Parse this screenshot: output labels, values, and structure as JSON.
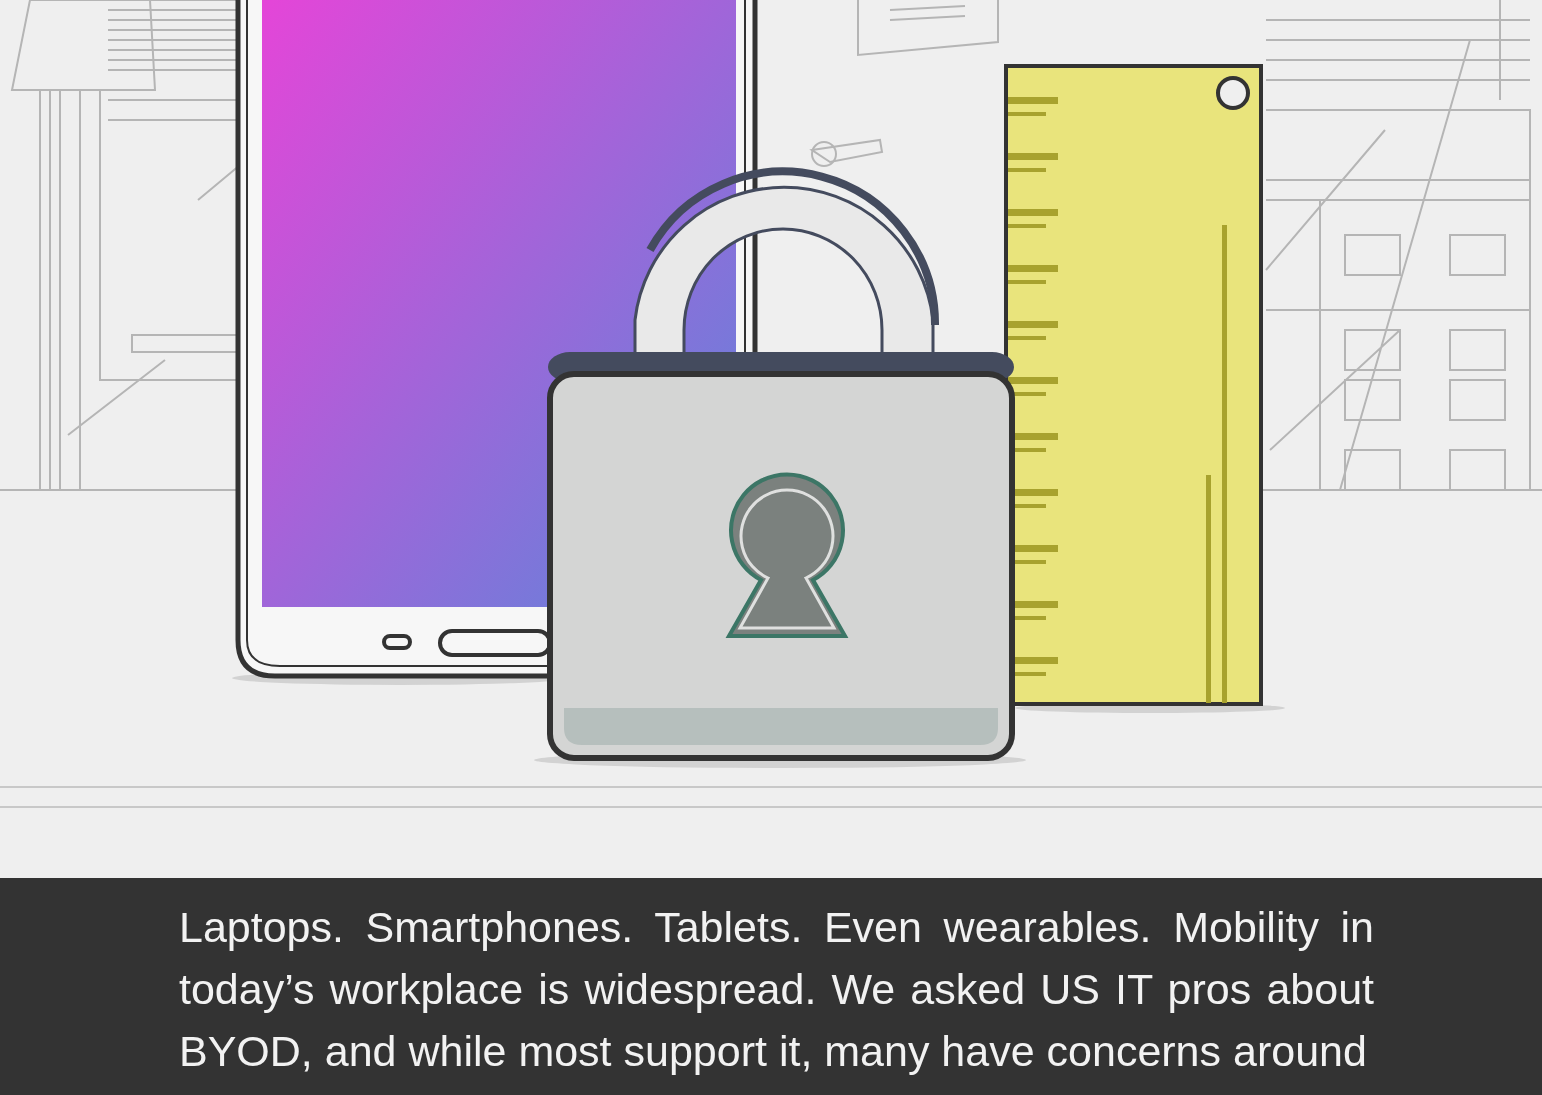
{
  "intro": {
    "text": "Laptops. Smartphones. Tablets. Even wearables. Mobility in today’s workplace is widespread. We asked US IT pros about BYOD, and while most support it, many have concerns around"
  }
}
